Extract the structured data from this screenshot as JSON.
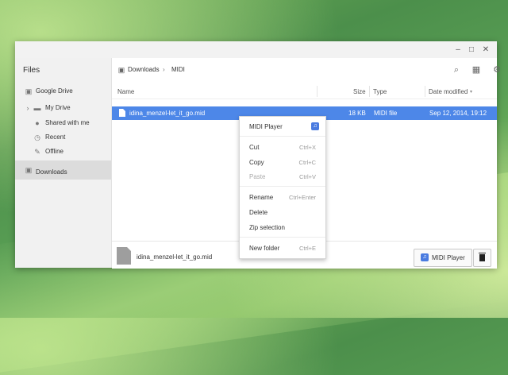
{
  "window": {
    "controls": {
      "minimize": "–",
      "maximize": "□",
      "close": "✕"
    }
  },
  "sidebar": {
    "title": "Files",
    "items": [
      {
        "label": "Google Drive",
        "icon": "drive-icon"
      },
      {
        "label": "My Drive",
        "icon": "folder-icon",
        "expander": "›"
      },
      {
        "label": "Shared with me",
        "icon": "people-icon"
      },
      {
        "label": "Recent",
        "icon": "clock-icon"
      },
      {
        "label": "Offline",
        "icon": "pin-icon"
      },
      {
        "label": "Downloads",
        "icon": "download-folder-icon",
        "selected": true
      }
    ]
  },
  "breadcrumb": {
    "root": "Downloads",
    "separator": "›",
    "current": "MIDI"
  },
  "toolbar": {
    "search_icon": "search-icon",
    "view_icon": "grid-view-icon",
    "settings_icon": "gear-icon"
  },
  "columns": {
    "name": "Name",
    "size": "Size",
    "type": "Type",
    "date": "Date modified",
    "sort_indicator": "▾"
  },
  "files": [
    {
      "name": "idina_menzel-let_it_go.mid",
      "size": "18 KB",
      "type": "MIDI file",
      "date": "Sep 12, 2014, 19:12",
      "selected": true
    }
  ],
  "bottom": {
    "filename": "idina_menzel-let_it_go.mid",
    "open_label": "MIDI Player",
    "app_badge": "♫"
  },
  "context_menu": {
    "open_with": {
      "label": "MIDI Player",
      "badge": "♫"
    },
    "cut": {
      "label": "Cut",
      "shortcut": "Ctrl+X"
    },
    "copy": {
      "label": "Copy",
      "shortcut": "Ctrl+C"
    },
    "paste": {
      "label": "Paste",
      "shortcut": "Ctrl+V",
      "disabled": true
    },
    "rename": {
      "label": "Rename",
      "shortcut": "Ctrl+Enter"
    },
    "delete": {
      "label": "Delete"
    },
    "zip": {
      "label": "Zip selection"
    },
    "new_folder": {
      "label": "New folder",
      "shortcut": "Ctrl+E"
    }
  },
  "colors": {
    "accent": "#4d87e8",
    "sidebar_bg": "#f1f1f1",
    "selected_sidebar": "#dcdcdc"
  }
}
